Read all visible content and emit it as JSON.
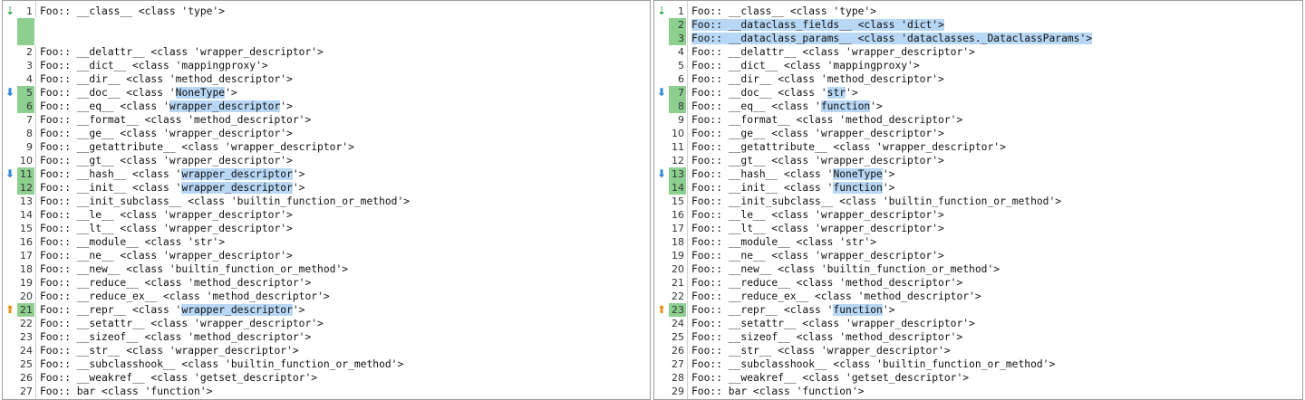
{
  "left": {
    "rows": [
      {
        "num": "1",
        "pre": "Foo:: __class__ <class 'type'>",
        "hl": "",
        "post": "",
        "marker": "both",
        "kind": "normal"
      },
      {
        "num": "",
        "pre": "",
        "hl": "",
        "post": "",
        "marker": "",
        "kind": "filler"
      },
      {
        "num": "",
        "pre": "",
        "hl": "",
        "post": "",
        "marker": "",
        "kind": "filler"
      },
      {
        "num": "2",
        "pre": "Foo:: __delattr__ <class 'wrapper_descriptor'>",
        "hl": "",
        "post": "",
        "marker": "",
        "kind": "normal"
      },
      {
        "num": "3",
        "pre": "Foo:: __dict__ <class 'mappingproxy'>",
        "hl": "",
        "post": "",
        "marker": "",
        "kind": "normal"
      },
      {
        "num": "4",
        "pre": "Foo:: __dir__ <class 'method_descriptor'>",
        "hl": "",
        "post": "",
        "marker": "",
        "kind": "normal"
      },
      {
        "num": "5",
        "pre": "Foo:: __doc__ <class '",
        "hl": "NoneType",
        "post": "'>",
        "marker": "down",
        "kind": "changed"
      },
      {
        "num": "6",
        "pre": "Foo:: __eq__ <class '",
        "hl": "wrapper_descriptor",
        "post": "'>",
        "marker": "",
        "kind": "changed"
      },
      {
        "num": "7",
        "pre": "Foo:: __format__ <class 'method_descriptor'>",
        "hl": "",
        "post": "",
        "marker": "",
        "kind": "normal"
      },
      {
        "num": "8",
        "pre": "Foo:: __ge__ <class 'wrapper_descriptor'>",
        "hl": "",
        "post": "",
        "marker": "",
        "kind": "normal"
      },
      {
        "num": "9",
        "pre": "Foo:: __getattribute__ <class 'wrapper_descriptor'>",
        "hl": "",
        "post": "",
        "marker": "",
        "kind": "normal"
      },
      {
        "num": "10",
        "pre": "Foo:: __gt__ <class 'wrapper_descriptor'>",
        "hl": "",
        "post": "",
        "marker": "",
        "kind": "normal"
      },
      {
        "num": "11",
        "pre": "Foo:: __hash__ <class '",
        "hl": "wrapper_descriptor",
        "post": "'>",
        "marker": "down",
        "kind": "changed"
      },
      {
        "num": "12",
        "pre": "Foo:: __init__ <class '",
        "hl": "wrapper_descriptor",
        "post": "'>",
        "marker": "",
        "kind": "changed"
      },
      {
        "num": "13",
        "pre": "Foo:: __init_subclass__ <class 'builtin_function_or_method'>",
        "hl": "",
        "post": "",
        "marker": "",
        "kind": "normal"
      },
      {
        "num": "14",
        "pre": "Foo:: __le__ <class 'wrapper_descriptor'>",
        "hl": "",
        "post": "",
        "marker": "",
        "kind": "normal"
      },
      {
        "num": "15",
        "pre": "Foo:: __lt__ <class 'wrapper_descriptor'>",
        "hl": "",
        "post": "",
        "marker": "",
        "kind": "normal"
      },
      {
        "num": "16",
        "pre": "Foo:: __module__ <class 'str'>",
        "hl": "",
        "post": "",
        "marker": "",
        "kind": "normal"
      },
      {
        "num": "17",
        "pre": "Foo:: __ne__ <class 'wrapper_descriptor'>",
        "hl": "",
        "post": "",
        "marker": "",
        "kind": "normal"
      },
      {
        "num": "18",
        "pre": "Foo:: __new__ <class 'builtin_function_or_method'>",
        "hl": "",
        "post": "",
        "marker": "",
        "kind": "normal"
      },
      {
        "num": "19",
        "pre": "Foo:: __reduce__ <class 'method_descriptor'>",
        "hl": "",
        "post": "",
        "marker": "",
        "kind": "normal"
      },
      {
        "num": "20",
        "pre": "Foo:: __reduce_ex__ <class 'method_descriptor'>",
        "hl": "",
        "post": "",
        "marker": "",
        "kind": "normal"
      },
      {
        "num": "21",
        "pre": "Foo:: __repr__ <class '",
        "hl": "wrapper_descriptor",
        "post": "'>",
        "marker": "up",
        "kind": "changed"
      },
      {
        "num": "22",
        "pre": "Foo:: __setattr__ <class 'wrapper_descriptor'>",
        "hl": "",
        "post": "",
        "marker": "",
        "kind": "normal"
      },
      {
        "num": "23",
        "pre": "Foo:: __sizeof__ <class 'method_descriptor'>",
        "hl": "",
        "post": "",
        "marker": "",
        "kind": "normal"
      },
      {
        "num": "24",
        "pre": "Foo:: __str__ <class 'wrapper_descriptor'>",
        "hl": "",
        "post": "",
        "marker": "",
        "kind": "normal"
      },
      {
        "num": "25",
        "pre": "Foo:: __subclasshook__ <class 'builtin_function_or_method'>",
        "hl": "",
        "post": "",
        "marker": "",
        "kind": "normal"
      },
      {
        "num": "26",
        "pre": "Foo:: __weakref__ <class 'getset_descriptor'>",
        "hl": "",
        "post": "",
        "marker": "",
        "kind": "normal"
      },
      {
        "num": "27",
        "pre": "Foo:: bar <class 'function'>",
        "hl": "",
        "post": "",
        "marker": "",
        "kind": "normal"
      }
    ]
  },
  "right": {
    "rows": [
      {
        "num": "1",
        "pre": "Foo:: __class__ <class 'type'>",
        "hl": "",
        "post": "",
        "marker": "both",
        "kind": "normal"
      },
      {
        "num": "2",
        "pre": "",
        "hl": "Foo:: __dataclass_fields__ <class 'dict'>",
        "post": "",
        "marker": "",
        "kind": "added"
      },
      {
        "num": "3",
        "pre": "",
        "hl": "Foo:: __dataclass_params__ <class 'dataclasses._DataclassParams'>",
        "post": "",
        "marker": "",
        "kind": "added"
      },
      {
        "num": "4",
        "pre": "Foo:: __delattr__ <class 'wrapper_descriptor'>",
        "hl": "",
        "post": "",
        "marker": "",
        "kind": "normal"
      },
      {
        "num": "5",
        "pre": "Foo:: __dict__ <class 'mappingproxy'>",
        "hl": "",
        "post": "",
        "marker": "",
        "kind": "normal"
      },
      {
        "num": "6",
        "pre": "Foo:: __dir__ <class 'method_descriptor'>",
        "hl": "",
        "post": "",
        "marker": "",
        "kind": "normal"
      },
      {
        "num": "7",
        "pre": "Foo:: __doc__ <class '",
        "hl": "str",
        "post": "'>",
        "marker": "down",
        "kind": "changed"
      },
      {
        "num": "8",
        "pre": "Foo:: __eq__ <class '",
        "hl": "function",
        "post": "'>",
        "marker": "",
        "kind": "changed"
      },
      {
        "num": "9",
        "pre": "Foo:: __format__ <class 'method_descriptor'>",
        "hl": "",
        "post": "",
        "marker": "",
        "kind": "normal"
      },
      {
        "num": "10",
        "pre": "Foo:: __ge__ <class 'wrapper_descriptor'>",
        "hl": "",
        "post": "",
        "marker": "",
        "kind": "normal"
      },
      {
        "num": "11",
        "pre": "Foo:: __getattribute__ <class 'wrapper_descriptor'>",
        "hl": "",
        "post": "",
        "marker": "",
        "kind": "normal"
      },
      {
        "num": "12",
        "pre": "Foo:: __gt__ <class 'wrapper_descriptor'>",
        "hl": "",
        "post": "",
        "marker": "",
        "kind": "normal"
      },
      {
        "num": "13",
        "pre": "Foo:: __hash__ <class '",
        "hl": "NoneType",
        "post": "'>",
        "marker": "down",
        "kind": "changed"
      },
      {
        "num": "14",
        "pre": "Foo:: __init__ <class '",
        "hl": "function",
        "post": "'>",
        "marker": "",
        "kind": "changed"
      },
      {
        "num": "15",
        "pre": "Foo:: __init_subclass__ <class 'builtin_function_or_method'>",
        "hl": "",
        "post": "",
        "marker": "",
        "kind": "normal"
      },
      {
        "num": "16",
        "pre": "Foo:: __le__ <class 'wrapper_descriptor'>",
        "hl": "",
        "post": "",
        "marker": "",
        "kind": "normal"
      },
      {
        "num": "17",
        "pre": "Foo:: __lt__ <class 'wrapper_descriptor'>",
        "hl": "",
        "post": "",
        "marker": "",
        "kind": "normal"
      },
      {
        "num": "18",
        "pre": "Foo:: __module__ <class 'str'>",
        "hl": "",
        "post": "",
        "marker": "",
        "kind": "normal"
      },
      {
        "num": "19",
        "pre": "Foo:: __ne__ <class 'wrapper_descriptor'>",
        "hl": "",
        "post": "",
        "marker": "",
        "kind": "normal"
      },
      {
        "num": "20",
        "pre": "Foo:: __new__ <class 'builtin_function_or_method'>",
        "hl": "",
        "post": "",
        "marker": "",
        "kind": "normal"
      },
      {
        "num": "21",
        "pre": "Foo:: __reduce__ <class 'method_descriptor'>",
        "hl": "",
        "post": "",
        "marker": "",
        "kind": "normal"
      },
      {
        "num": "22",
        "pre": "Foo:: __reduce_ex__ <class 'method_descriptor'>",
        "hl": "",
        "post": "",
        "marker": "",
        "kind": "normal"
      },
      {
        "num": "23",
        "pre": "Foo:: __repr__ <class '",
        "hl": "function",
        "post": "'>",
        "marker": "up",
        "kind": "changed"
      },
      {
        "num": "24",
        "pre": "Foo:: __setattr__ <class 'wrapper_descriptor'>",
        "hl": "",
        "post": "",
        "marker": "",
        "kind": "normal"
      },
      {
        "num": "25",
        "pre": "Foo:: __sizeof__ <class 'method_descriptor'>",
        "hl": "",
        "post": "",
        "marker": "",
        "kind": "normal"
      },
      {
        "num": "26",
        "pre": "Foo:: __str__ <class 'wrapper_descriptor'>",
        "hl": "",
        "post": "",
        "marker": "",
        "kind": "normal"
      },
      {
        "num": "27",
        "pre": "Foo:: __subclasshook__ <class 'builtin_function_or_method'>",
        "hl": "",
        "post": "",
        "marker": "",
        "kind": "normal"
      },
      {
        "num": "28",
        "pre": "Foo:: __weakref__ <class 'getset_descriptor'>",
        "hl": "",
        "post": "",
        "marker": "",
        "kind": "normal"
      },
      {
        "num": "29",
        "pre": "Foo:: bar <class 'function'>",
        "hl": "",
        "post": "",
        "marker": "",
        "kind": "normal"
      }
    ]
  },
  "icons": {
    "next_change": "arrow-down-icon",
    "prev_change": "arrow-up-icon",
    "first_change": "double-arrow-icon"
  },
  "colors": {
    "changed_line_number_bg": "#8ccf8e",
    "highlight_bg": "#b7d7f5",
    "next_arrow": "#2e8ad8",
    "prev_arrow": "#e8901c"
  }
}
